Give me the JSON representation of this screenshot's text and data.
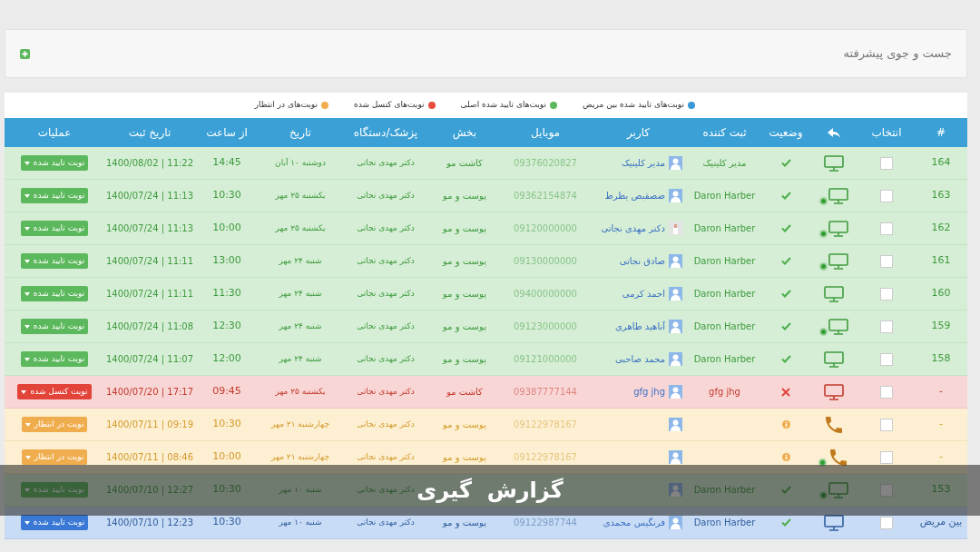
{
  "search_panel": {
    "title": "جست و جوی پیشرفته"
  },
  "legend": [
    {
      "label": "نوبت‌های تایید شده بین مریض",
      "color": "#3a9ad9"
    },
    {
      "label": "نوبت‌های تایید شده اصلی",
      "color": "#5cb85c"
    },
    {
      "label": "نوبت‌های کنسل شده",
      "color": "#e74c3c"
    },
    {
      "label": "نوبت‌های در انتظار",
      "color": "#f0ad4e"
    }
  ],
  "table": {
    "columns": [
      {
        "kind": "text",
        "label": "#"
      },
      {
        "kind": "text",
        "label": "انتخاب"
      },
      {
        "kind": "icon"
      },
      {
        "kind": "text",
        "label": "وضعیت"
      },
      {
        "kind": "text",
        "label": "ثبت کننده"
      },
      {
        "kind": "text",
        "label": "کاربر"
      },
      {
        "kind": "text",
        "label": "موبایل"
      },
      {
        "kind": "text",
        "label": "بخش"
      },
      {
        "kind": "text",
        "label": "پزشک/دستگاه"
      },
      {
        "kind": "text",
        "label": "تاریخ"
      },
      {
        "kind": "text",
        "label": "از ساعت"
      },
      {
        "kind": "text",
        "label": "تاریخ ثبت"
      },
      {
        "kind": "text",
        "label": "عملیات"
      }
    ],
    "rows": [
      {
        "number": "164",
        "kind": "confirmed",
        "checked": false,
        "device": {
          "kind": "monitor",
          "online": false
        },
        "registrar": "مدیر کلینیک",
        "avatar": {
          "kind": "default"
        },
        "user": "مدیر کلینیک",
        "mobile": "09376020827",
        "section": "کاشت مو",
        "doctor": "دکتر مهدی نجاتی",
        "date": "دوشنبه ۱۰ آبان",
        "time": "14:45",
        "registered": "1400/08/02 | 11:22",
        "action": "نوبت تایید شده"
      },
      {
        "number": "163",
        "kind": "confirmed",
        "checked": false,
        "device": {
          "kind": "monitor",
          "online": true
        },
        "registrar": "Daron Harber",
        "avatar": {
          "kind": "default"
        },
        "user": "ضصقبص یظرط",
        "mobile": "09362154874",
        "section": "پوست و مو",
        "doctor": "دکتر مهدی نجاتی",
        "date": "یکشنبه ۲۵ مهر",
        "time": "10:30",
        "registered": "1400/07/24 | 11:13",
        "action": "نوبت تایید شده"
      },
      {
        "number": "162",
        "kind": "confirmed",
        "checked": false,
        "device": {
          "kind": "monitor",
          "online": true
        },
        "registrar": "Daron Harber",
        "avatar": {
          "kind": "photo"
        },
        "user": "دکتر مهدی نجاتی",
        "mobile": "09120000000",
        "section": "پوست و مو",
        "doctor": "دکتر مهدی نجاتی",
        "date": "یکشنبه ۲۵ مهر",
        "time": "10:00",
        "registered": "1400/07/24 | 11:13",
        "action": "نوبت تایید شده"
      },
      {
        "number": "161",
        "kind": "confirmed",
        "checked": false,
        "device": {
          "kind": "monitor",
          "online": true
        },
        "registrar": "Daron Harber",
        "avatar": {
          "kind": "default"
        },
        "user": "صادق نجاتی",
        "mobile": "09130000000",
        "section": "پوست و مو",
        "doctor": "دکتر مهدی نجاتی",
        "date": "شنبه ۲۴ مهر",
        "time": "13:00",
        "registered": "1400/07/24 | 11:11",
        "action": "نوبت تایید شده"
      },
      {
        "number": "160",
        "kind": "confirmed",
        "checked": false,
        "device": {
          "kind": "monitor",
          "online": false
        },
        "registrar": "Daron Harber",
        "avatar": {
          "kind": "default"
        },
        "user": "احمد کرمی",
        "mobile": "09400000000",
        "section": "پوست و مو",
        "doctor": "دکتر مهدی نجاتی",
        "date": "شنبه ۲۴ مهر",
        "time": "11:30",
        "registered": "1400/07/24 | 11:11",
        "action": "نوبت تایید شده"
      },
      {
        "number": "159",
        "kind": "confirmed",
        "checked": false,
        "device": {
          "kind": "monitor",
          "online": true
        },
        "registrar": "Daron Harber",
        "avatar": {
          "kind": "default"
        },
        "user": "آناهید طاهری",
        "mobile": "09123000000",
        "section": "پوست و مو",
        "doctor": "دکتر مهدی نجاتی",
        "date": "شنبه ۲۴ مهر",
        "time": "12:30",
        "registered": "1400/07/24 | 11:08",
        "action": "نوبت تایید شده"
      },
      {
        "number": "158",
        "kind": "confirmed",
        "checked": false,
        "device": {
          "kind": "monitor",
          "online": false
        },
        "registrar": "Daron Harber",
        "avatar": {
          "kind": "default"
        },
        "user": "محمد صاحبی",
        "mobile": "09121000000",
        "section": "پوست و مو",
        "doctor": "دکتر مهدی نجاتی",
        "date": "شنبه ۲۴ مهر",
        "time": "12:00",
        "registered": "1400/07/24 | 11:07",
        "action": "نوبت تایید شده"
      },
      {
        "number": "-",
        "kind": "cancelled",
        "checked": false,
        "device": {
          "kind": "monitor",
          "online": false
        },
        "registrar": "gfg jhg",
        "avatar": {
          "kind": "default"
        },
        "user": "gfg jhg",
        "mobile": "09387777144",
        "section": "کاشت مو",
        "doctor": "دکتر مهدی نجاتی",
        "date": "یکشنبه ۲۵ مهر",
        "time": "09:45",
        "registered": "1400/07/20 | 17:17",
        "action": "نوبت کنسل شده"
      },
      {
        "number": "-",
        "kind": "pending",
        "checked": false,
        "device": {
          "kind": "phone",
          "online": false
        },
        "avatar": {
          "kind": "default"
        },
        "mobile": "09122978167",
        "section": "پوست و مو",
        "doctor": "دکتر مهدی نجاتی",
        "date": "چهارشنبه ۲۱ مهر",
        "time": "10:30",
        "registered": "1400/07/11 | 09:19",
        "action": "نوبت در انتظار"
      },
      {
        "number": "-",
        "kind": "pending",
        "checked": false,
        "device": {
          "kind": "phone",
          "online": true
        },
        "avatar": {
          "kind": "default"
        },
        "mobile": "09122978167",
        "section": "پوست و مو",
        "doctor": "دکتر مهدی نجاتی",
        "date": "چهارشنبه ۲۱ مهر",
        "time": "10:00",
        "registered": "1400/07/11 | 08:46",
        "action": "نوبت در انتظار"
      },
      {
        "number": "153",
        "kind": "confirmed",
        "checked": false,
        "device": {
          "kind": "monitor",
          "online": true
        },
        "registrar": "Daron Harber",
        "avatar": {
          "kind": "default"
        },
        "doctor": "دکتر مهدی نجاتی",
        "date": "شنبه ۱۰ مهر",
        "time": "10:30",
        "registered": "1400/07/10 | 12:27",
        "action": "نوبت تایید شده"
      },
      {
        "number": "بین مریض",
        "kind": "inpatient",
        "checked": false,
        "device": {
          "kind": "monitor",
          "online": false
        },
        "registrar": "Daron Harber",
        "avatar": {
          "kind": "default"
        },
        "user": "فرنگیس محمدی",
        "mobile": "09122987744",
        "section": "پوست و مو",
        "doctor": "دکتر مهدی نجاتی",
        "date": "شنبه ۱۰ مهر",
        "time": "10:30",
        "registered": "1400/07/10 | 12:23",
        "action": "نوبت تایید شده"
      }
    ]
  },
  "caption": "گزارش  گیری"
}
